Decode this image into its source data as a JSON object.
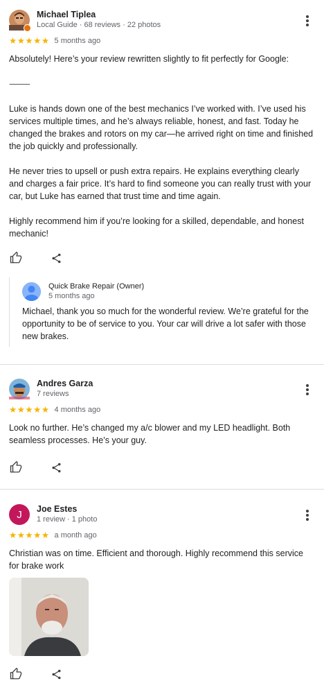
{
  "reviews": [
    {
      "author": "Michael Tiplea",
      "meta": "Local Guide · 68 reviews · 22 photos",
      "stars": "★★★★★",
      "date": "5 months ago",
      "text": "Absolutely! Here’s your review rewritten slightly to fit perfectly for Google:\n\n⸻\n\nLuke is hands down one of the best mechanics I’ve worked with. I’ve used his services multiple times, and he’s always reliable, honest, and fast. Today he changed the brakes and rotors on my car—he arrived right on time and finished the job quickly and professionally.\n\nHe never tries to upsell or push extra repairs. He explains everything clearly and charges a fair price. It’s hard to find someone you can really trust with your car, but Luke has earned that trust time and time again.\n\nHighly recommend him if you’re looking for a skilled, dependable, and honest mechanic!",
      "reply": {
        "owner": "Quick Brake Repair (Owner)",
        "date": "5 months ago",
        "text": "Michael, thank you so much for the wonderful review. We’re grateful for the opportunity to be of service to you. Your car will drive a lot safer with those new brakes."
      }
    },
    {
      "author": "Andres Garza",
      "meta": "7 reviews",
      "stars": "★★★★★",
      "date": "4 months ago",
      "text": "Look no further. He’s changed my a/c blower and my LED headlight. Both seamless processes. He’s your guy."
    },
    {
      "author": "Joe Estes",
      "avatar_letter": "J",
      "meta": "1 review · 1 photo",
      "stars": "★★★★★",
      "date": "a month ago",
      "text": "Christian was on time. Efficient and thorough. Highly recommend this service for brake work"
    }
  ],
  "icons": {
    "like": "thumbs-up-icon",
    "share": "share-icon",
    "more": "more-vert-icon"
  },
  "colors": {
    "star": "#f4b400",
    "avatar_j": "#c2185b",
    "owner_avatar": "#8ab4f8"
  }
}
